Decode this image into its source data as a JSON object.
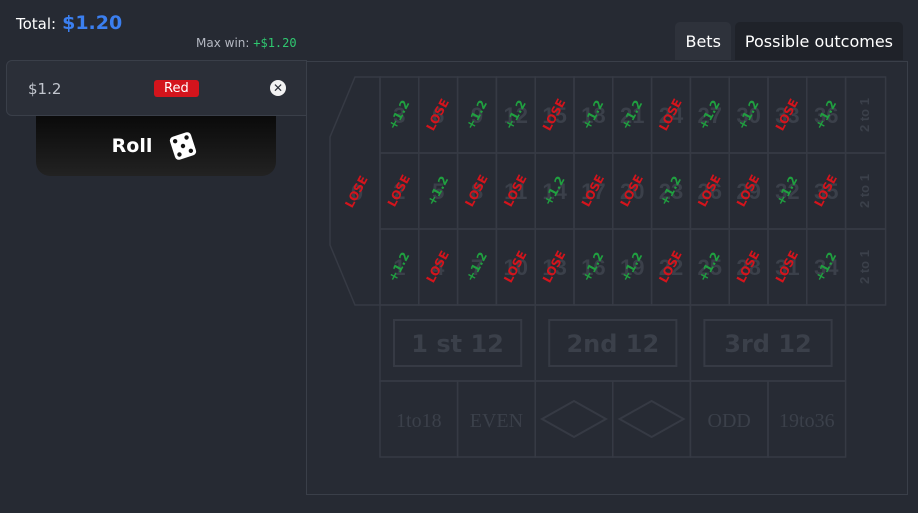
{
  "header": {
    "total_label": "Total:",
    "total_value": "$1.20",
    "max_win_label": "Max win:",
    "max_win_value": "+$1.20"
  },
  "tabs": [
    {
      "label": "Bets",
      "active": false
    },
    {
      "label": "Possible outcomes",
      "active": true
    }
  ],
  "bet": {
    "amount": "$1.2",
    "color_label": "Red",
    "badge_color": "#d4141c",
    "remove_icon": "close-circle-icon"
  },
  "roll_button": {
    "label": "Roll",
    "icon": "dice-icon"
  },
  "board": {
    "zero_label": "0",
    "zero_outcome": "LOSE",
    "rows": [
      {
        "numbers": [
          "3",
          "6",
          "9",
          "12",
          "15",
          "18",
          "21",
          "24",
          "27",
          "30",
          "33",
          "36"
        ],
        "outcomes": [
          "+1.2",
          "LOSE",
          "+1.2",
          "+1.2",
          "LOSE",
          "+1.2",
          "+1.2",
          "LOSE",
          "+1.2",
          "+1.2",
          "LOSE",
          "+1.2"
        ]
      },
      {
        "numbers": [
          "2",
          "5",
          "8",
          "11",
          "14",
          "17",
          "20",
          "23",
          "26",
          "29",
          "32",
          "35"
        ],
        "outcomes": [
          "LOSE",
          "+1.2",
          "LOSE",
          "LOSE",
          "+1.2",
          "LOSE",
          "LOSE",
          "+1.2",
          "LOSE",
          "LOSE",
          "+1.2",
          "LOSE"
        ]
      },
      {
        "numbers": [
          "1",
          "4",
          "7",
          "10",
          "13",
          "16",
          "19",
          "22",
          "25",
          "28",
          "31",
          "34"
        ],
        "outcomes": [
          "+1.2",
          "LOSE",
          "+1.2",
          "LOSE",
          "LOSE",
          "+1.2",
          "+1.2",
          "LOSE",
          "+1.2",
          "LOSE",
          "LOSE",
          "+1.2"
        ]
      }
    ],
    "column_labels": [
      "2 to 1",
      "2 to 1",
      "2 to 1"
    ],
    "dozens": [
      "1 st 12",
      "2nd 12",
      "3rd 12"
    ],
    "outside": [
      "1to18",
      "EVEN",
      "",
      "",
      "ODD",
      "19to36"
    ],
    "colors": {
      "win": "#20a040",
      "lose": "#d4141c",
      "lines": "#363a44",
      "faded_text": "#3b404a"
    }
  }
}
